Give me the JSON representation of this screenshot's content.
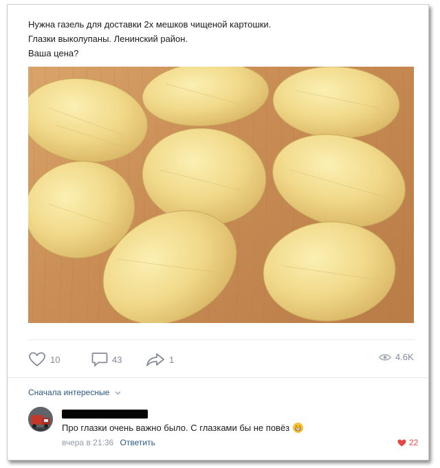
{
  "post": {
    "lines": [
      "Нужна газель для доставки 2х мешков чищеной картошки.",
      "Глазки выколупаны. Ленинский район.",
      "Ваша цена?"
    ]
  },
  "actions": {
    "likes": "10",
    "comments": "43",
    "shares": "1",
    "views": "4.6K"
  },
  "comments_section": {
    "sort_label": "Сначала интересные"
  },
  "comment": {
    "text": "Про глазки очень важно было. С глазками бы не повёз",
    "time": "вчера в 21:36",
    "reply_label": "Ответить",
    "likes": "22"
  },
  "colors": {
    "link": "#2a5885",
    "muted": "#828a99",
    "like_red": "#e64646",
    "potato": "#f2dc8a",
    "board": "#c98d55"
  },
  "icons": [
    "heart-icon",
    "comment-icon",
    "share-icon",
    "eye-icon",
    "chevron-down-icon",
    "grin-emoji-icon",
    "heart-filled-icon"
  ]
}
